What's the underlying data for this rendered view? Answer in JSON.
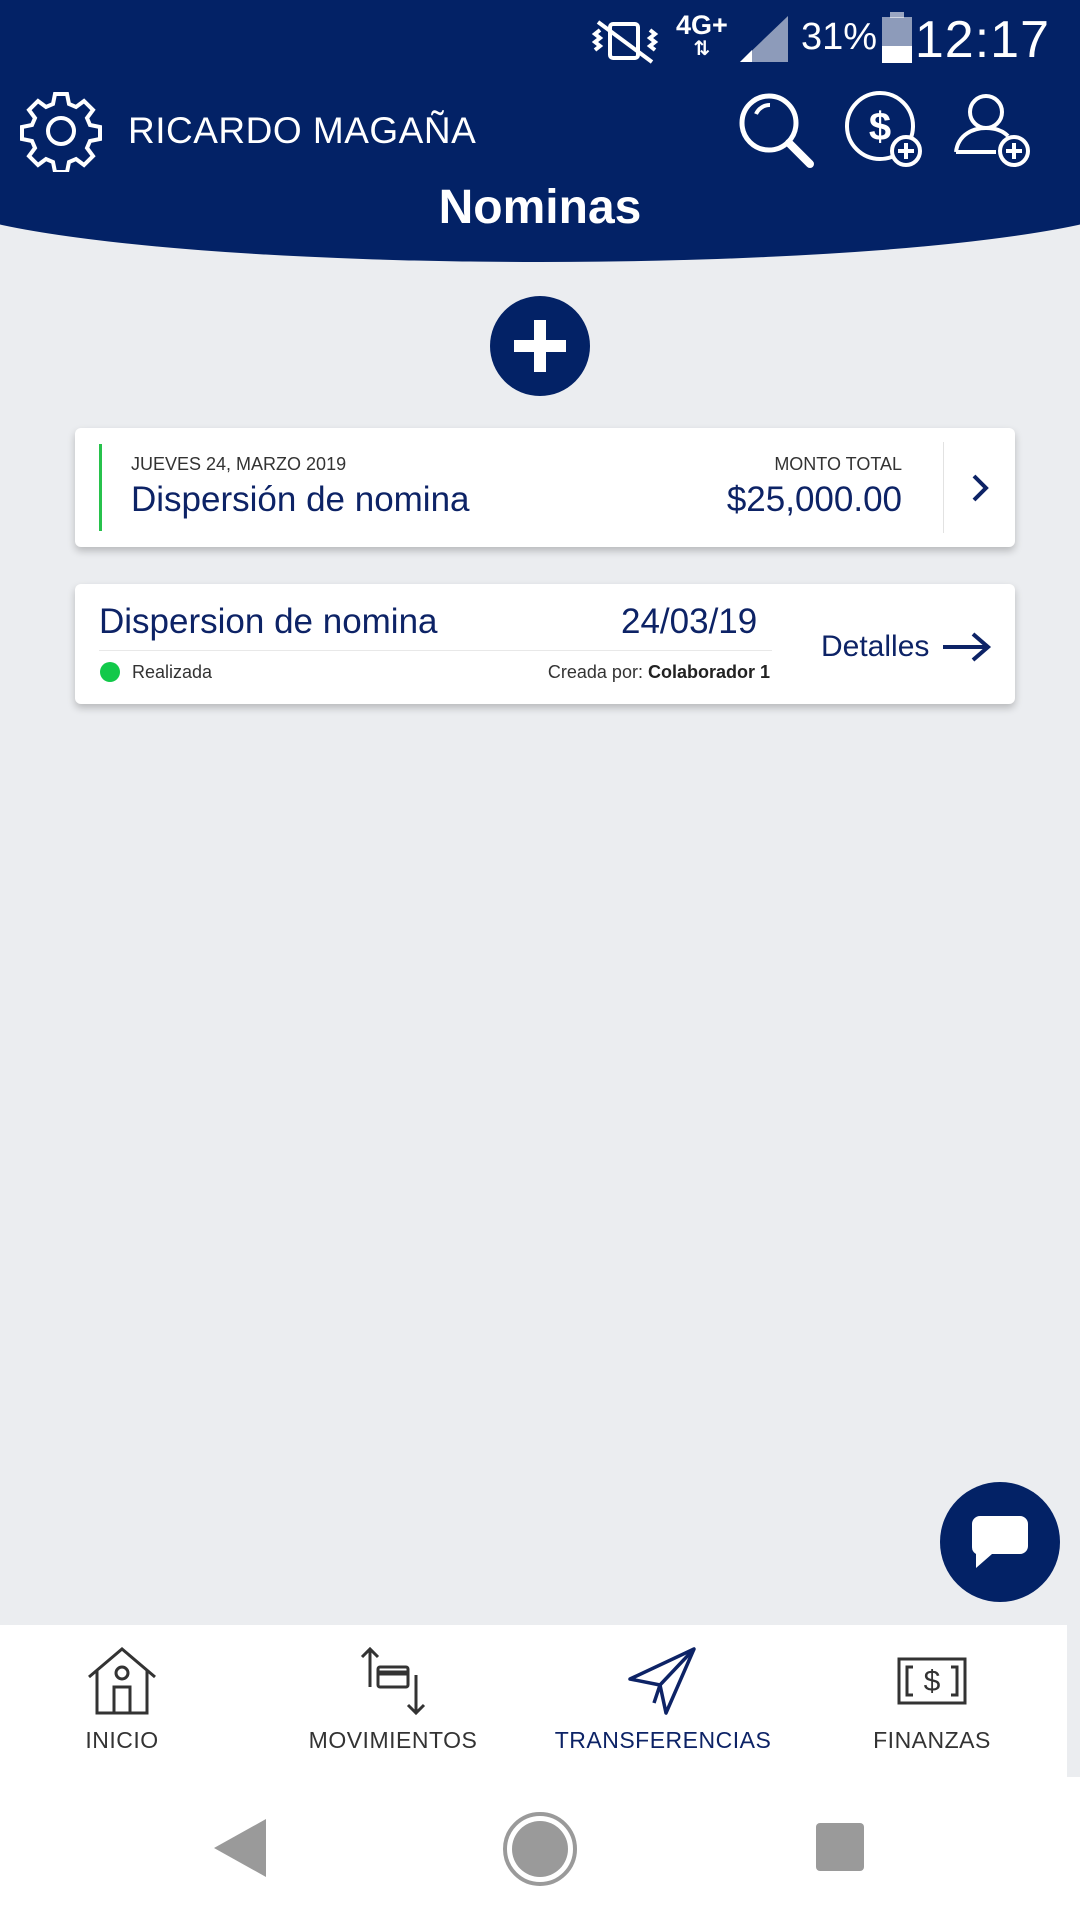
{
  "status_bar": {
    "network": "4G+",
    "battery": "31%",
    "time": "12:17"
  },
  "header": {
    "user_name": "RICARDO MAGAÑA",
    "title": "Nominas",
    "icons": [
      "gear-icon",
      "search-icon",
      "add-money-icon",
      "add-user-icon"
    ]
  },
  "summary_card": {
    "date": "JUEVES 24, MARZO 2019",
    "title": "Dispersión de nomina",
    "total_label": "MONTO TOTAL",
    "total_value": "$25,000.00"
  },
  "payroll_card": {
    "title": "Dispersion de nomina",
    "date": "24/03/19",
    "status": "Realizada",
    "creator_prefix": "Creada por:",
    "creator_name": "Colaborador 1",
    "details_label": "Detalles"
  },
  "bottom_nav": {
    "items": [
      {
        "label": "INICIO",
        "icon": "home-icon"
      },
      {
        "label": "MOVIMIENTOS",
        "icon": "transfer-arrows-icon"
      },
      {
        "label": "TRANSFERENCIAS",
        "icon": "paper-plane-icon",
        "active": true
      },
      {
        "label": "FINANZAS",
        "icon": "money-bill-icon"
      }
    ]
  },
  "colors": {
    "brand_navy": "#032266",
    "text_navy": "#0d2366",
    "success_green": "#12c94a",
    "background": "#ebedf0"
  }
}
